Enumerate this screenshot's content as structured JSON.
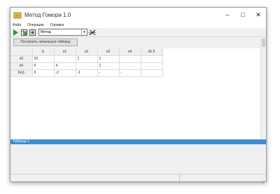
{
  "window": {
    "title": "Метод Гомори 1.0",
    "controls": {
      "minimize": "–",
      "maximize": "□",
      "close": "✕"
    }
  },
  "menu": {
    "items": [
      "Файл",
      "Операции",
      "Справка"
    ]
  },
  "toolbar": {
    "method_select": "Метод",
    "icons": [
      "play-icon",
      "table-icon",
      "image-icon",
      "split-icon"
    ]
  },
  "action_button": "Построить начальную таблицу",
  "table": {
    "headers": [
      "",
      "b",
      "x1",
      "x2",
      "x3",
      "x4",
      "х5 Х"
    ],
    "rows": [
      {
        "label": "x3",
        "cells": [
          "10",
          "",
          "1",
          "1",
          "",
          ""
        ]
      },
      {
        "label": "x4",
        "cells": [
          "6",
          "4",
          "",
          "1",
          "",
          ""
        ]
      },
      {
        "label": "F(x)",
        "cells": [
          "0",
          "-2",
          "-1",
          "-",
          "-",
          ""
        ]
      }
    ]
  },
  "info_bar": "Таблица 1",
  "colors": {
    "accent": "#3b8ed8",
    "play": "#2a9a2a"
  }
}
